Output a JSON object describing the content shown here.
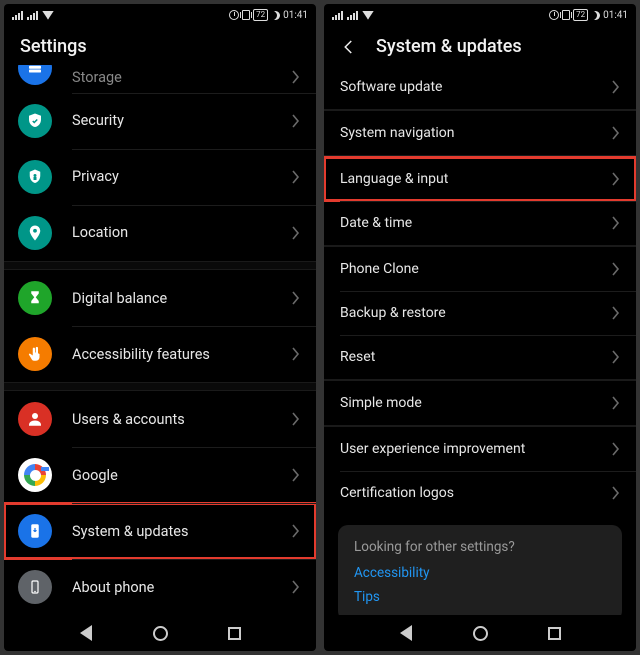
{
  "status": {
    "battery": "72",
    "time": "01:41"
  },
  "left": {
    "title": "Settings",
    "items": [
      {
        "key": "storage",
        "label": "Storage",
        "icon": "storage-icon",
        "color": "c-blue",
        "truncated": true
      },
      {
        "key": "security",
        "label": "Security",
        "icon": "shield-check-icon",
        "color": "c-teal"
      },
      {
        "key": "privacy",
        "label": "Privacy",
        "icon": "privacy-icon",
        "color": "c-teal"
      },
      {
        "key": "location",
        "label": "Location",
        "icon": "location-pin-icon",
        "color": "c-teal"
      }
    ],
    "group2": [
      {
        "key": "digital",
        "label": "Digital balance",
        "icon": "hourglass-icon",
        "color": "c-green"
      },
      {
        "key": "accessibility",
        "label": "Accessibility features",
        "icon": "hand-icon",
        "color": "c-orange"
      }
    ],
    "group3": [
      {
        "key": "users",
        "label": "Users & accounts",
        "icon": "user-icon",
        "color": "c-red"
      },
      {
        "key": "google",
        "label": "Google",
        "icon": "google-icon",
        "color": "c-google"
      },
      {
        "key": "system",
        "label": "System & updates",
        "icon": "phone-update-icon",
        "color": "c-blue",
        "highlight": true
      },
      {
        "key": "about",
        "label": "About phone",
        "icon": "phone-info-icon",
        "color": "c-grey"
      }
    ]
  },
  "right": {
    "title": "System & updates",
    "g1": [
      {
        "key": "swupdate",
        "label": "Software update"
      }
    ],
    "g2": [
      {
        "key": "sysnav",
        "label": "System navigation"
      }
    ],
    "g3": [
      {
        "key": "lang",
        "label": "Language & input",
        "highlight": true
      },
      {
        "key": "datetime",
        "label": "Date & time"
      }
    ],
    "g4": [
      {
        "key": "clone",
        "label": "Phone Clone"
      },
      {
        "key": "backup",
        "label": "Backup & restore"
      },
      {
        "key": "reset",
        "label": "Reset"
      }
    ],
    "g5": [
      {
        "key": "simple",
        "label": "Simple mode"
      }
    ],
    "g6": [
      {
        "key": "ux",
        "label": "User experience improvement"
      },
      {
        "key": "cert",
        "label": "Certification logos"
      }
    ],
    "hint": {
      "title": "Looking for other settings?",
      "links": [
        "Accessibility",
        "Tips"
      ]
    }
  }
}
